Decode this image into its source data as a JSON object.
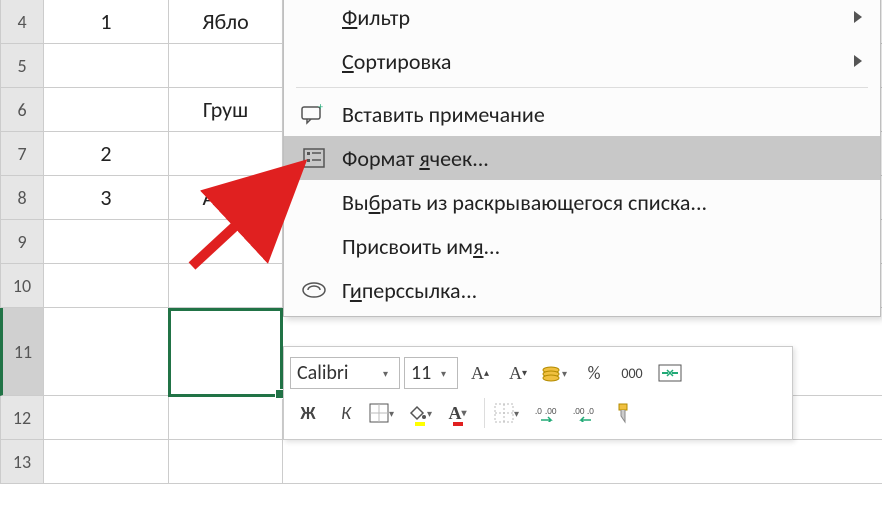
{
  "rows": {
    "headers": [
      "4",
      "5",
      "6",
      "7",
      "8",
      "9",
      "10",
      "11",
      "12",
      "13"
    ],
    "colA": [
      "1",
      "",
      "",
      "2",
      "3",
      "",
      "",
      "",
      "",
      ""
    ],
    "colB": [
      "Ябло",
      "",
      "Груш",
      "",
      "Апел",
      "",
      "",
      "",
      "",
      ""
    ]
  },
  "contextMenu": {
    "filter": "ильтр",
    "filterM": "Ф",
    "sort": "ортировка",
    "sortM": "С",
    "insertComment": "Вставить примечание",
    "formatCells1": "Формат ",
    "formatCellsM": "я",
    "formatCells2": "чеек...",
    "pickFromList1": "Вы",
    "pickFromListM": "б",
    "pickFromList2": "рать из раскрывающегося списка...",
    "defineName1": "Присвоить им",
    "defineNameM": "я",
    "defineName2": "...",
    "hyperlink1": "Г",
    "hyperlinkM": "и",
    "hyperlink2": "перссылка..."
  },
  "miniToolbar": {
    "fontName": "Calibri",
    "fontSize": "11",
    "bold": "Ж",
    "italic": "К",
    "percent": "%",
    "comma": "000"
  }
}
